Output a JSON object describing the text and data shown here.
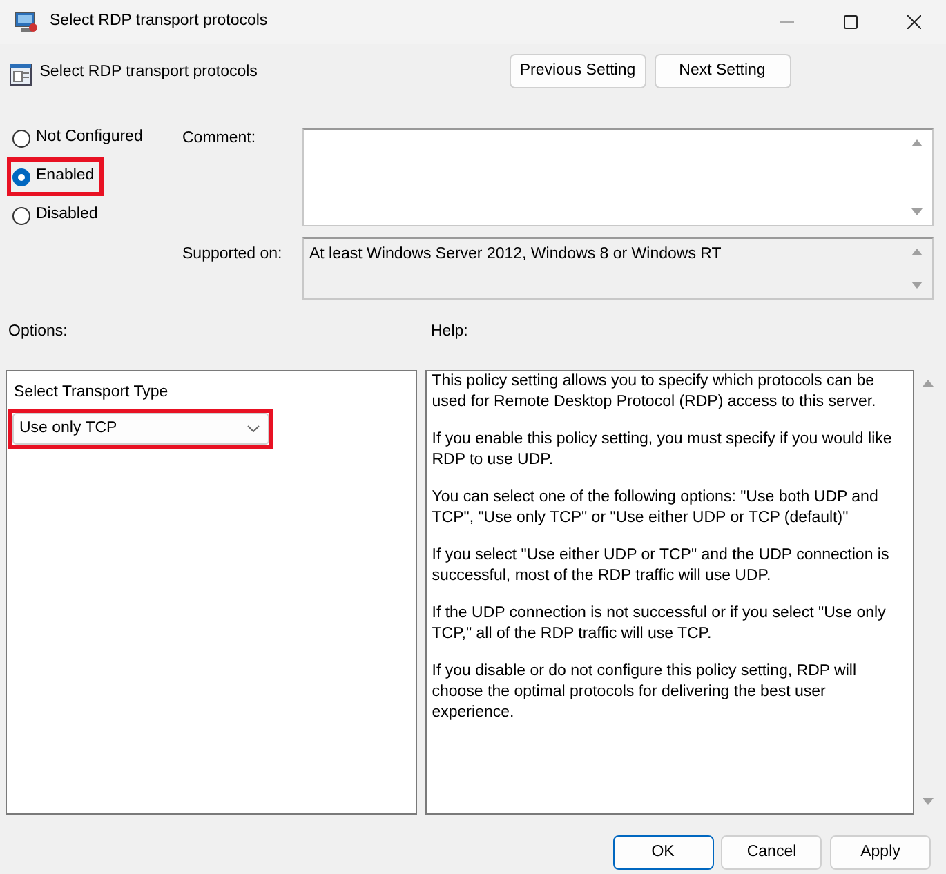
{
  "window": {
    "title": "Select RDP transport protocols"
  },
  "header": {
    "policy_name": "Select RDP transport protocols",
    "buttons": [
      {
        "label": "Previous Setting"
      },
      {
        "label": "Next Setting"
      }
    ]
  },
  "state_options": [
    {
      "label": "Not Configured",
      "selected": false,
      "highlighted": false
    },
    {
      "label": "Enabled",
      "selected": true,
      "highlighted": true
    },
    {
      "label": "Disabled",
      "selected": false,
      "highlighted": false
    }
  ],
  "comment": {
    "label": "Comment:"
  },
  "supported_on": {
    "label": "Supported on:",
    "value": "At least Windows Server 2012, Windows 8 or Windows RT"
  },
  "options": {
    "label": "Options:",
    "fields": [
      {
        "kind": "dropdown",
        "label": "Select Transport Type",
        "value": "Use only TCP",
        "highlighted": true
      }
    ]
  },
  "help": {
    "label": "Help:",
    "paragraphs": [
      "This policy setting allows you to specify which protocols can be used for Remote Desktop Protocol (RDP) access to this server.",
      "If you enable this policy setting, you must specify if you would like RDP to use UDP.",
      "You can select one of the following options: \"Use both UDP and TCP\", \"Use only TCP\" or \"Use either UDP or TCP (default)\"",
      "If you select \"Use either UDP or TCP\" and the UDP connection is successful, most of the RDP traffic will use UDP.",
      "If the UDP connection is not successful or if you select \"Use only TCP,\" all of the RDP traffic will use TCP.",
      "If you disable or do not configure this policy setting, RDP will choose the optimal protocols for delivering the best user experience."
    ]
  },
  "buttons": [
    {
      "label": "OK",
      "default": true
    },
    {
      "label": "Cancel",
      "default": false
    },
    {
      "label": "Apply",
      "default": false
    }
  ]
}
